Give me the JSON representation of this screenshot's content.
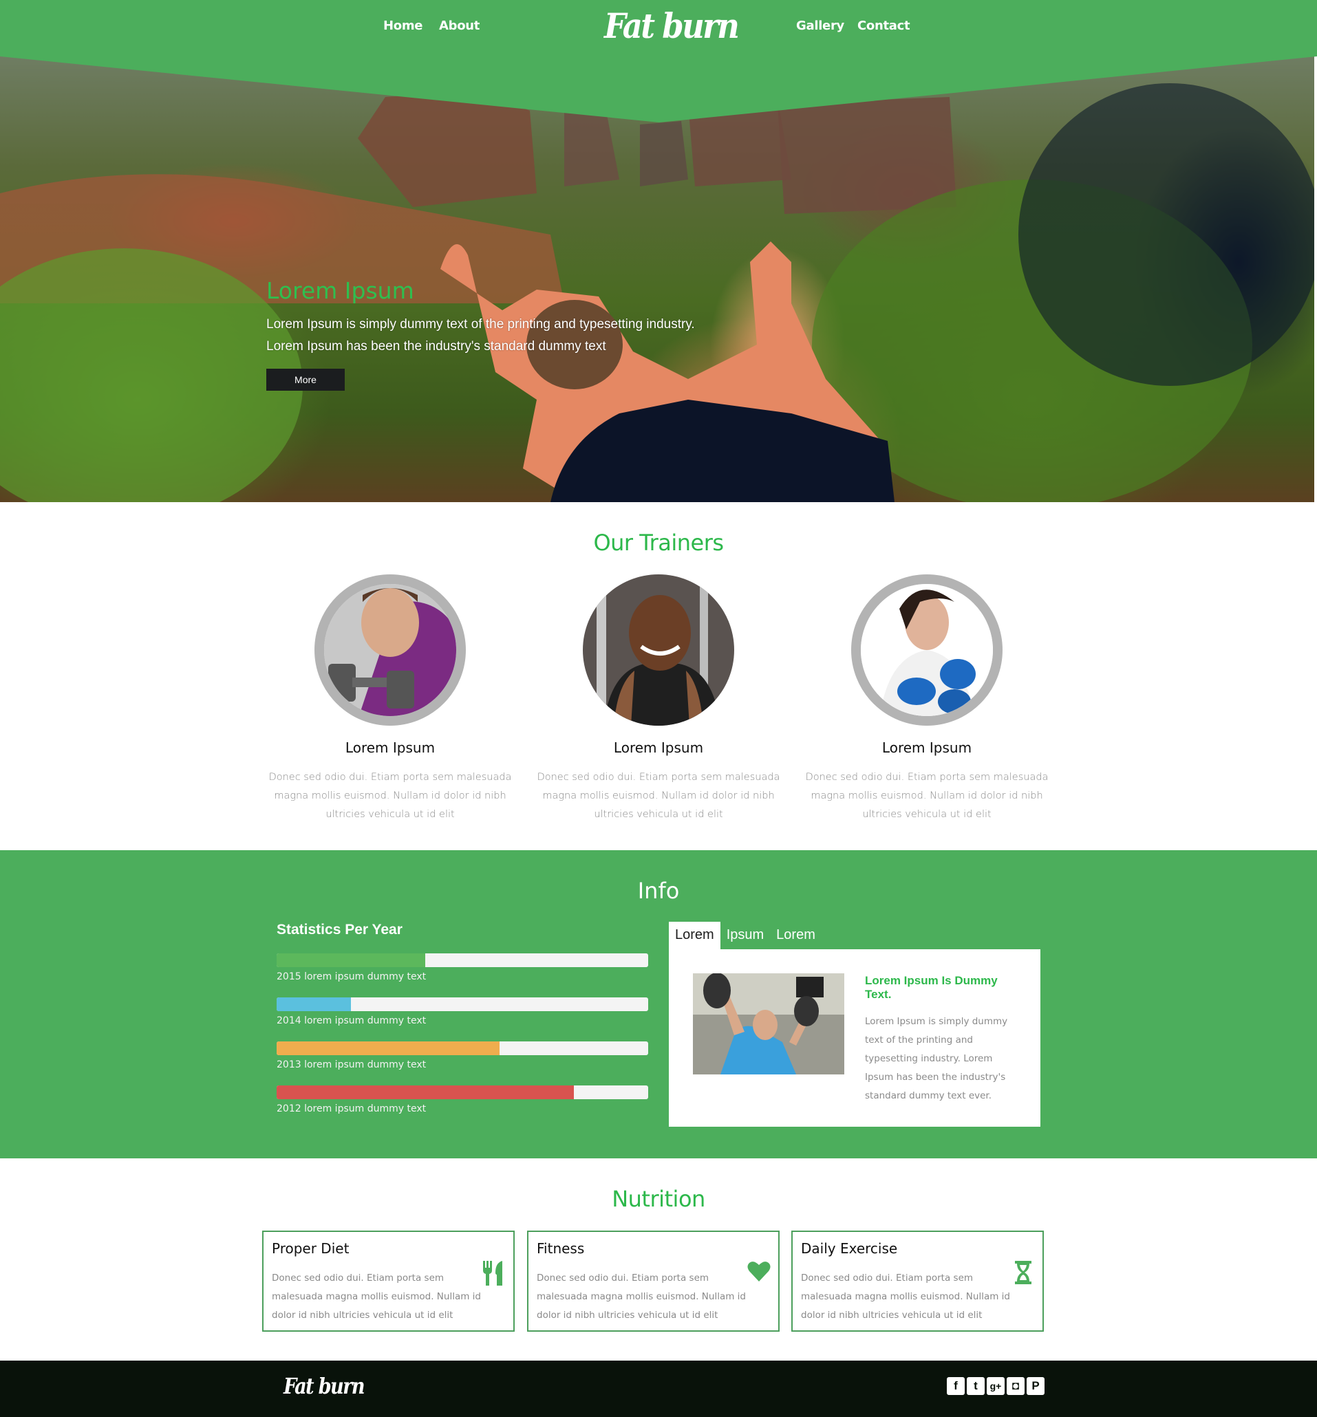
{
  "header": {
    "nav_left": [
      {
        "label": "Home"
      },
      {
        "label": "About"
      }
    ],
    "logo": "Fat burn",
    "nav_right": [
      {
        "label": "Gallery"
      },
      {
        "label": "Contact"
      }
    ],
    "brand_color": "#4cae5c"
  },
  "hero": {
    "title": "Lorem Ipsum",
    "line1": "Lorem Ipsum is simply dummy text of the printing and typesetting industry.",
    "line2": "Lorem Ipsum has been the industry's standard dummy text",
    "button_label": "More",
    "image": "yoga-pose-in-canyon-photo"
  },
  "trainers": {
    "title": "Our Trainers",
    "items": [
      {
        "name": "Lorem Ipsum",
        "desc": "Donec sed odio dui. Etiam porta sem malesuada magna mollis euismod. Nullam id dolor id nibh ultricies vehicula ut id elit",
        "image": "woman-with-dumbbell-photo"
      },
      {
        "name": "Lorem Ipsum",
        "desc": "Donec sed odio dui. Etiam porta sem malesuada magna mollis euismod. Nullam id dolor id nibh ultricies vehicula ut id elit",
        "image": "man-in-gym-photo"
      },
      {
        "name": "Lorem Ipsum",
        "desc": "Donec sed odio dui. Etiam porta sem malesuada magna mollis euismod. Nullam id dolor id nibh ultricies vehicula ut id elit",
        "image": "woman-with-blue-dumbbells-photo"
      }
    ]
  },
  "info": {
    "title": "Info",
    "stats_title": "Statistics Per Year",
    "stats": [
      {
        "label": "2015 lorem ipsum dummy text",
        "percent": 40,
        "color": "#5cb85c"
      },
      {
        "label": "2014 lorem ipsum dummy text",
        "percent": 20,
        "color": "#5bc0de"
      },
      {
        "label": "2013 lorem ipsum dummy text",
        "percent": 60,
        "color": "#f0ad4e"
      },
      {
        "label": "2012 lorem ipsum dummy text",
        "percent": 80,
        "color": "#d9534f"
      }
    ],
    "tabs": [
      {
        "label": "Lorem",
        "active": true
      },
      {
        "label": "Ipsum"
      },
      {
        "label": "Lorem"
      }
    ],
    "panel": {
      "heading": "Lorem Ipsum Is Dummy Text.",
      "text": "Lorem Ipsum is simply dummy text of the printing and typesetting industry. Lorem Ipsum has been the industry's standard dummy text ever.",
      "image": "woman-shoulder-press-photo"
    }
  },
  "nutrition": {
    "title": "Nutrition",
    "cards": [
      {
        "title": "Proper Diet",
        "text": "Donec sed odio dui. Etiam porta sem malesuada magna mollis euismod. Nullam id dolor id nibh ultricies vehicula ut id elit",
        "icon": "cutlery-icon"
      },
      {
        "title": "Fitness",
        "text": "Donec sed odio dui. Etiam porta sem malesuada magna mollis euismod. Nullam id dolor id nibh ultricies vehicula ut id elit",
        "icon": "heart-icon"
      },
      {
        "title": "Daily Exercise",
        "text": "Donec sed odio dui. Etiam porta sem malesuada magna mollis euismod. Nullam id dolor id nibh ultricies vehicula ut id elit",
        "icon": "hourglass-icon"
      }
    ]
  },
  "footer": {
    "logo": "Fat burn",
    "social": [
      {
        "name": "facebook",
        "glyph": "f"
      },
      {
        "name": "twitter",
        "glyph": "t"
      },
      {
        "name": "google-plus",
        "glyph": "g+"
      },
      {
        "name": "instagram",
        "glyph": "◘"
      },
      {
        "name": "pinterest",
        "glyph": "P"
      }
    ]
  }
}
